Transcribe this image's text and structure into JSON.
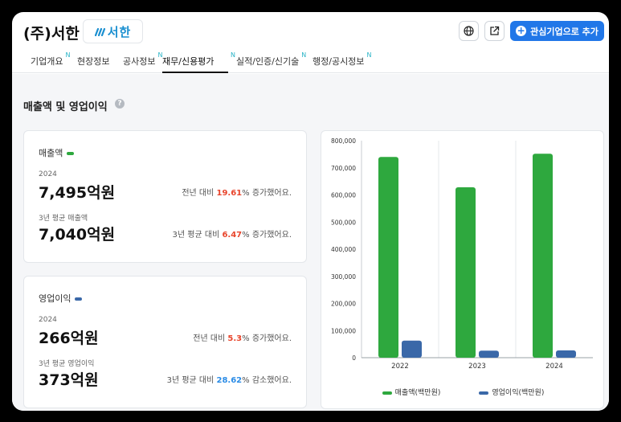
{
  "header": {
    "company_name": "(주)서한",
    "logo_text": "서한",
    "favorite_button_label": "관심기업으로 추가"
  },
  "tabs": [
    {
      "label": "기업개요",
      "new": "N"
    },
    {
      "label": "현장정보",
      "new": ""
    },
    {
      "label": "공사정보",
      "new": "N"
    },
    {
      "label": "재무/신용평가",
      "new": "N",
      "active": true
    },
    {
      "label": "실적/인증/신기술",
      "new": "N"
    },
    {
      "label": "행정/공시정보",
      "new": "N"
    }
  ],
  "section": {
    "title": "매출액 및 영업이익",
    "help": "?"
  },
  "revenue": {
    "label": "매출액",
    "year": "2024",
    "value": "7,495억원",
    "cmp_prefix": "전년 대비 ",
    "cmp_pct": "19.61",
    "cmp_suffix": "% 증가했어요.",
    "avg_label": "3년 평균 매출액",
    "avg_value": "7,040억원",
    "avg_cmp_prefix": "3년 평균 대비 ",
    "avg_cmp_pct": "6.47",
    "avg_cmp_suffix": "% 증가했어요."
  },
  "operating_profit": {
    "label": "영업이익",
    "year": "2024",
    "value": "266억원",
    "cmp_prefix": "전년 대비 ",
    "cmp_pct": "5.3",
    "cmp_suffix": "% 증가했어요.",
    "avg_label": "3년 평균 영업이익",
    "avg_value": "373억원",
    "avg_cmp_prefix": "3년 평균 대비 ",
    "avg_cmp_pct": "28.62",
    "avg_cmp_suffix": "% 감소했어요."
  },
  "colors": {
    "revenue": "#2ea83e",
    "profit": "#3a68a8",
    "accent": "#2177e8",
    "up": "#e8452c",
    "down": "#2b8ce6"
  },
  "icons": {
    "globe": "globe-icon",
    "external": "external-link-icon",
    "plus": "plus-circle-icon",
    "help": "question-icon"
  },
  "chart_data": {
    "type": "bar",
    "categories": [
      "2022",
      "2023",
      "2024"
    ],
    "series": [
      {
        "name": "매출액(백만원)",
        "values": [
          740000,
          628000,
          752000
        ],
        "color": "#2ea83e"
      },
      {
        "name": "영업이익(백만원)",
        "values": [
          63000,
          26000,
          27000
        ],
        "color": "#3a68a8"
      }
    ],
    "ylim": [
      0,
      800000
    ],
    "yticks": [
      0,
      100000,
      200000,
      300000,
      400000,
      500000,
      600000,
      700000,
      800000
    ],
    "ytick_labels": [
      "0",
      "100,000",
      "200,000",
      "300,000",
      "400,000",
      "500,000",
      "600,000",
      "700,000",
      "800,000"
    ],
    "grid": true,
    "legend": "bottom"
  }
}
